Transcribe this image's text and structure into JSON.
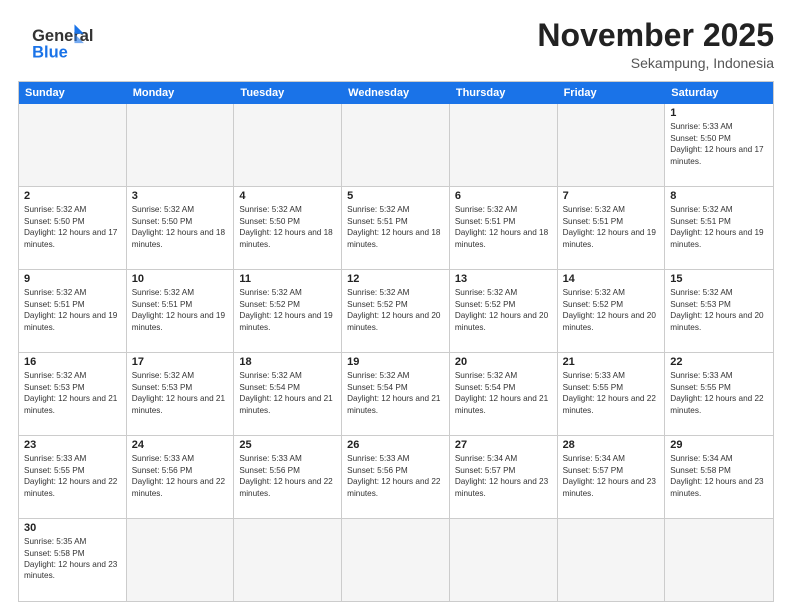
{
  "header": {
    "logo_general": "General",
    "logo_blue": "Blue",
    "month_title": "November 2025",
    "location": "Sekampung, Indonesia"
  },
  "weekdays": [
    "Sunday",
    "Monday",
    "Tuesday",
    "Wednesday",
    "Thursday",
    "Friday",
    "Saturday"
  ],
  "rows": [
    [
      {
        "day": "",
        "empty": true
      },
      {
        "day": "",
        "empty": true
      },
      {
        "day": "",
        "empty": true
      },
      {
        "day": "",
        "empty": true
      },
      {
        "day": "",
        "empty": true
      },
      {
        "day": "",
        "empty": true
      },
      {
        "day": "1",
        "sunrise": "5:33 AM",
        "sunset": "5:50 PM",
        "daylight": "12 hours and 17 minutes."
      }
    ],
    [
      {
        "day": "2",
        "sunrise": "5:32 AM",
        "sunset": "5:50 PM",
        "daylight": "12 hours and 17 minutes."
      },
      {
        "day": "3",
        "sunrise": "5:32 AM",
        "sunset": "5:50 PM",
        "daylight": "12 hours and 18 minutes."
      },
      {
        "day": "4",
        "sunrise": "5:32 AM",
        "sunset": "5:50 PM",
        "daylight": "12 hours and 18 minutes."
      },
      {
        "day": "5",
        "sunrise": "5:32 AM",
        "sunset": "5:51 PM",
        "daylight": "12 hours and 18 minutes."
      },
      {
        "day": "6",
        "sunrise": "5:32 AM",
        "sunset": "5:51 PM",
        "daylight": "12 hours and 18 minutes."
      },
      {
        "day": "7",
        "sunrise": "5:32 AM",
        "sunset": "5:51 PM",
        "daylight": "12 hours and 19 minutes."
      },
      {
        "day": "8",
        "sunrise": "5:32 AM",
        "sunset": "5:51 PM",
        "daylight": "12 hours and 19 minutes."
      }
    ],
    [
      {
        "day": "9",
        "sunrise": "5:32 AM",
        "sunset": "5:51 PM",
        "daylight": "12 hours and 19 minutes."
      },
      {
        "day": "10",
        "sunrise": "5:32 AM",
        "sunset": "5:51 PM",
        "daylight": "12 hours and 19 minutes."
      },
      {
        "day": "11",
        "sunrise": "5:32 AM",
        "sunset": "5:52 PM",
        "daylight": "12 hours and 19 minutes."
      },
      {
        "day": "12",
        "sunrise": "5:32 AM",
        "sunset": "5:52 PM",
        "daylight": "12 hours and 20 minutes."
      },
      {
        "day": "13",
        "sunrise": "5:32 AM",
        "sunset": "5:52 PM",
        "daylight": "12 hours and 20 minutes."
      },
      {
        "day": "14",
        "sunrise": "5:32 AM",
        "sunset": "5:52 PM",
        "daylight": "12 hours and 20 minutes."
      },
      {
        "day": "15",
        "sunrise": "5:32 AM",
        "sunset": "5:53 PM",
        "daylight": "12 hours and 20 minutes."
      }
    ],
    [
      {
        "day": "16",
        "sunrise": "5:32 AM",
        "sunset": "5:53 PM",
        "daylight": "12 hours and 21 minutes."
      },
      {
        "day": "17",
        "sunrise": "5:32 AM",
        "sunset": "5:53 PM",
        "daylight": "12 hours and 21 minutes."
      },
      {
        "day": "18",
        "sunrise": "5:32 AM",
        "sunset": "5:54 PM",
        "daylight": "12 hours and 21 minutes."
      },
      {
        "day": "19",
        "sunrise": "5:32 AM",
        "sunset": "5:54 PM",
        "daylight": "12 hours and 21 minutes."
      },
      {
        "day": "20",
        "sunrise": "5:32 AM",
        "sunset": "5:54 PM",
        "daylight": "12 hours and 21 minutes."
      },
      {
        "day": "21",
        "sunrise": "5:33 AM",
        "sunset": "5:55 PM",
        "daylight": "12 hours and 22 minutes."
      },
      {
        "day": "22",
        "sunrise": "5:33 AM",
        "sunset": "5:55 PM",
        "daylight": "12 hours and 22 minutes."
      }
    ],
    [
      {
        "day": "23",
        "sunrise": "5:33 AM",
        "sunset": "5:55 PM",
        "daylight": "12 hours and 22 minutes."
      },
      {
        "day": "24",
        "sunrise": "5:33 AM",
        "sunset": "5:56 PM",
        "daylight": "12 hours and 22 minutes."
      },
      {
        "day": "25",
        "sunrise": "5:33 AM",
        "sunset": "5:56 PM",
        "daylight": "12 hours and 22 minutes."
      },
      {
        "day": "26",
        "sunrise": "5:33 AM",
        "sunset": "5:56 PM",
        "daylight": "12 hours and 22 minutes."
      },
      {
        "day": "27",
        "sunrise": "5:34 AM",
        "sunset": "5:57 PM",
        "daylight": "12 hours and 23 minutes."
      },
      {
        "day": "28",
        "sunrise": "5:34 AM",
        "sunset": "5:57 PM",
        "daylight": "12 hours and 23 minutes."
      },
      {
        "day": "29",
        "sunrise": "5:34 AM",
        "sunset": "5:58 PM",
        "daylight": "12 hours and 23 minutes."
      }
    ],
    [
      {
        "day": "30",
        "sunrise": "5:35 AM",
        "sunset": "5:58 PM",
        "daylight": "12 hours and 23 minutes."
      },
      {
        "day": "",
        "empty": true
      },
      {
        "day": "",
        "empty": true
      },
      {
        "day": "",
        "empty": true
      },
      {
        "day": "",
        "empty": true
      },
      {
        "day": "",
        "empty": true
      },
      {
        "day": "",
        "empty": true
      }
    ]
  ],
  "labels": {
    "sunrise_prefix": "Sunrise: ",
    "sunset_prefix": "Sunset: ",
    "daylight_prefix": "Daylight: "
  }
}
